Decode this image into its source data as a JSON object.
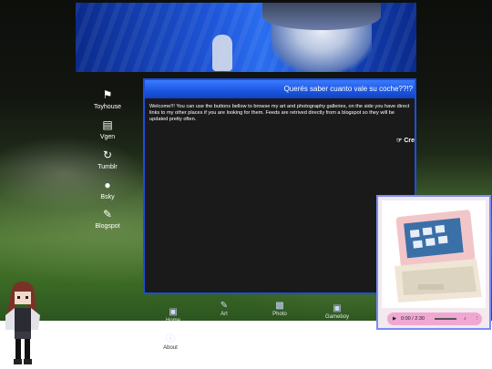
{
  "window": {
    "title": "Querés saber cuanto vale su coche??!?",
    "body": "Welcome!!! You can use the buttons bellow to browse my art and photography galleries, on the side you have direct links to my other places if you are looking for them. Feeds are retrived directly from a blogspot so they will be updated pretty often.",
    "cred_label": "Cre"
  },
  "side_links": [
    {
      "label": "Toyhouse",
      "icon": "toyhouse-icon"
    },
    {
      "label": "Vgen",
      "icon": "vgen-icon"
    },
    {
      "label": "Tumblr",
      "icon": "tumblr-icon"
    },
    {
      "label": "Bsky",
      "icon": "bsky-icon"
    },
    {
      "label": "Blogspot",
      "icon": "blogspot-icon"
    }
  ],
  "taskbar": [
    {
      "label": "Home",
      "icon": "home-icon"
    },
    {
      "label": "Art",
      "icon": "art-icon"
    },
    {
      "label": "Photo",
      "icon": "photo-icon"
    },
    {
      "label": "Gameboy",
      "icon": "gameboy-icon"
    },
    {
      "label": "About",
      "icon": "about-icon"
    }
  ],
  "player": {
    "time": "0:00 / 2:30"
  },
  "colors": {
    "window_border": "#1e4fd8",
    "titlebar": "#1a55e0",
    "popup_border": "#7a8df0",
    "player_bg": "#f0a8d2"
  }
}
